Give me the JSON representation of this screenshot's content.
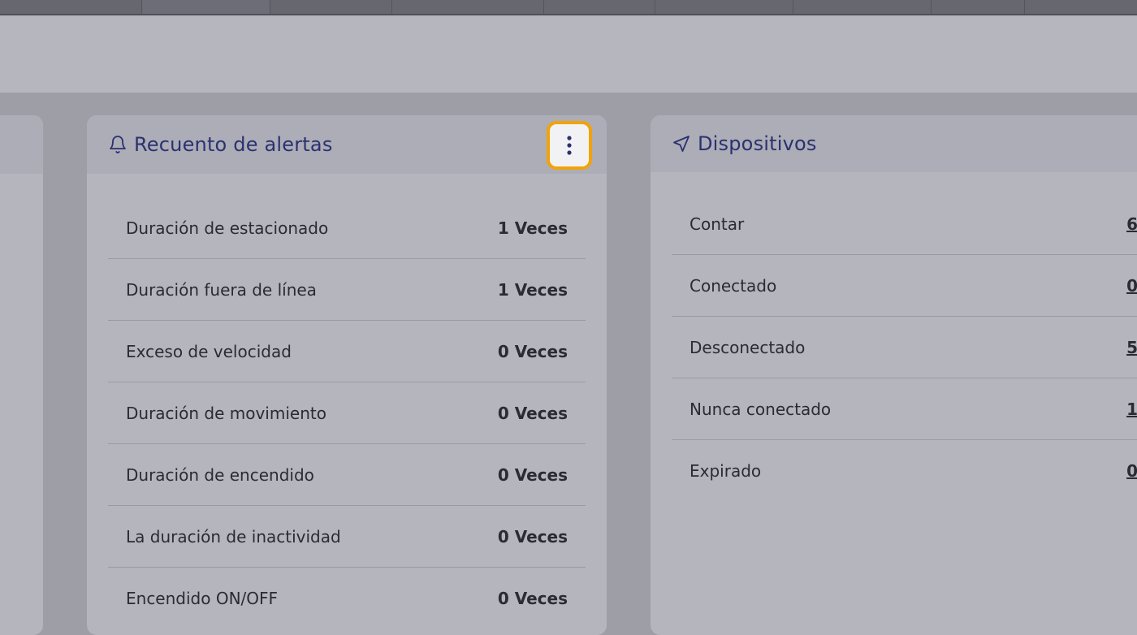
{
  "alerts_card": {
    "title": "Recuento de alertas",
    "title_icon": "bell-icon",
    "menu_icon": "vertical-dots-icon",
    "rows": [
      {
        "label": "Duración de estacionado",
        "value": "1 Veces"
      },
      {
        "label": "Duración fuera de línea",
        "value": "1 Veces"
      },
      {
        "label": "Exceso de velocidad",
        "value": "0 Veces"
      },
      {
        "label": "Duración de movimiento",
        "value": "0 Veces"
      },
      {
        "label": "Duración de encendido",
        "value": "0 Veces"
      },
      {
        "label": "La duración de inactividad",
        "value": "0 Veces"
      },
      {
        "label": "Encendido ON/OFF",
        "value": "0 Veces"
      }
    ]
  },
  "devices_card": {
    "title": "Dispositivos",
    "title_icon": "navigation-arrow-icon",
    "rows": [
      {
        "label": "Contar",
        "value": "6"
      },
      {
        "label": "Conectado",
        "value": "0"
      },
      {
        "label": "Desconectado",
        "value": "5"
      },
      {
        "label": "Nunca conectado",
        "value": "1"
      },
      {
        "label": "Expirado",
        "value": "0"
      }
    ]
  },
  "colors": {
    "accent_focus": "#f0a30a",
    "title_text": "#2b3170"
  }
}
